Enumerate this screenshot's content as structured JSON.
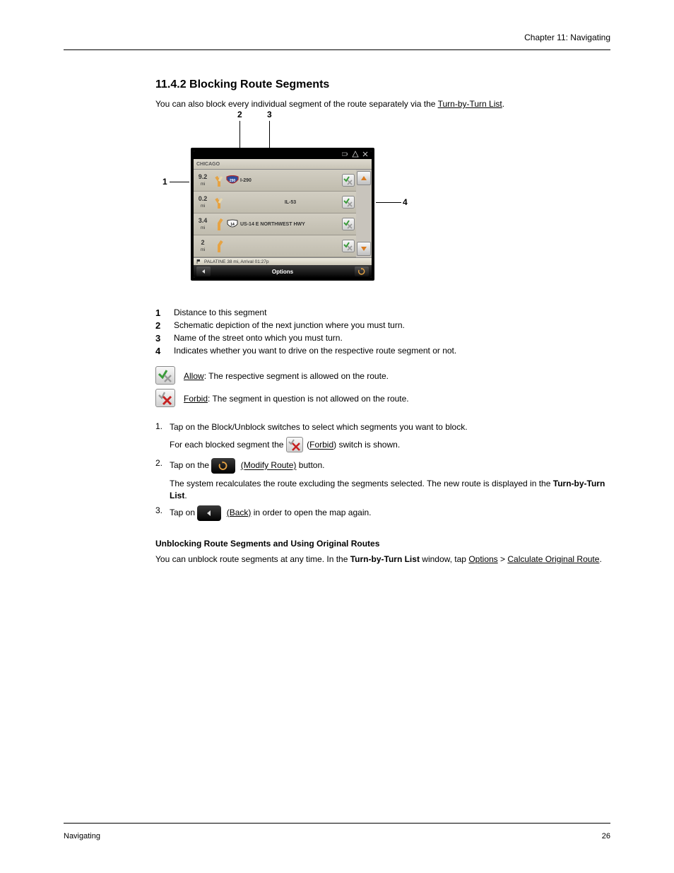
{
  "header": {
    "chapter": "Chapter 11: Navigating"
  },
  "h2": "11.4.2 Blocking Route Segments",
  "intro_lead": "You can also block every individual segment of the route separately via the ",
  "intro_link": "Turn-by-Turn List",
  "intro_tail": ".",
  "device": {
    "title": "CHICAGO",
    "rows": [
      {
        "dist": "9.2",
        "unit": "mi",
        "road": "I-290",
        "shield": "interstate",
        "shield_text": "290"
      },
      {
        "dist": "0.2",
        "unit": "mi",
        "road": "IL-53",
        "shield": "",
        "shield_text": ""
      },
      {
        "dist": "3.4",
        "unit": "mi",
        "road": "US-14 E NORTHWEST HWY",
        "shield": "us",
        "shield_text": "14"
      },
      {
        "dist": "2",
        "unit": "mi",
        "road": "",
        "shield": "",
        "shield_text": ""
      }
    ],
    "summary": "PALATINE 38 mi, Arrival 01:27p",
    "options_label": "Options"
  },
  "callouts": {
    "c1": "1",
    "c2": "2",
    "c3": "3",
    "c4": "4",
    "l1": "Distance to this segment",
    "l2": "Schematic depiction of the next junction where you must turn.",
    "l3": "Name of the street onto which you must turn.",
    "l4": "Indicates whether you want to drive on the respective route segment or not."
  },
  "seg_allow_label": "Allow",
  "seg_allow_desc": ": The respective segment is allowed on the route.",
  "seg_forbid_label": "Forbid",
  "seg_forbid_desc": ": The segment in question is not allowed on the route.",
  "step1": "Tap on the Block/Unblock switches to select which segments you want to block.",
  "step2_lead": "Tap on the ",
  "step2_btn": "(Modify Route)",
  "step2_tail": " button.",
  "step3_a": "The system recalculates the route excluding the segments selected. The new route is displayed in the ",
  "step3_b": "Turn-by-Turn List",
  "step3_c": ".",
  "step4_lead": "Tap on ",
  "step4_btn": "(Back)",
  "step4_tail": " in order to open the map again.",
  "unblock_title": "Unblocking Route Segments and Using Original Routes",
  "unblock_body_a": "You can unblock route segments at any time. In the ",
  "unblock_body_b": "Turn-by-Turn List",
  "unblock_body_c": " window, tap ",
  "unblock_body_d": "Options",
  "unblock_body_e": " > ",
  "unblock_body_f": "Calculate Original Route",
  "unblock_body_g": ".",
  "note_lead_lineA": "For each blocked segment the ",
  "note_lead_lineB": " (",
  "note_lead_lineC": "Forbid",
  "note_lead_lineD": ") switch is shown.",
  "footer": {
    "left": "Navigating",
    "right": "26"
  }
}
